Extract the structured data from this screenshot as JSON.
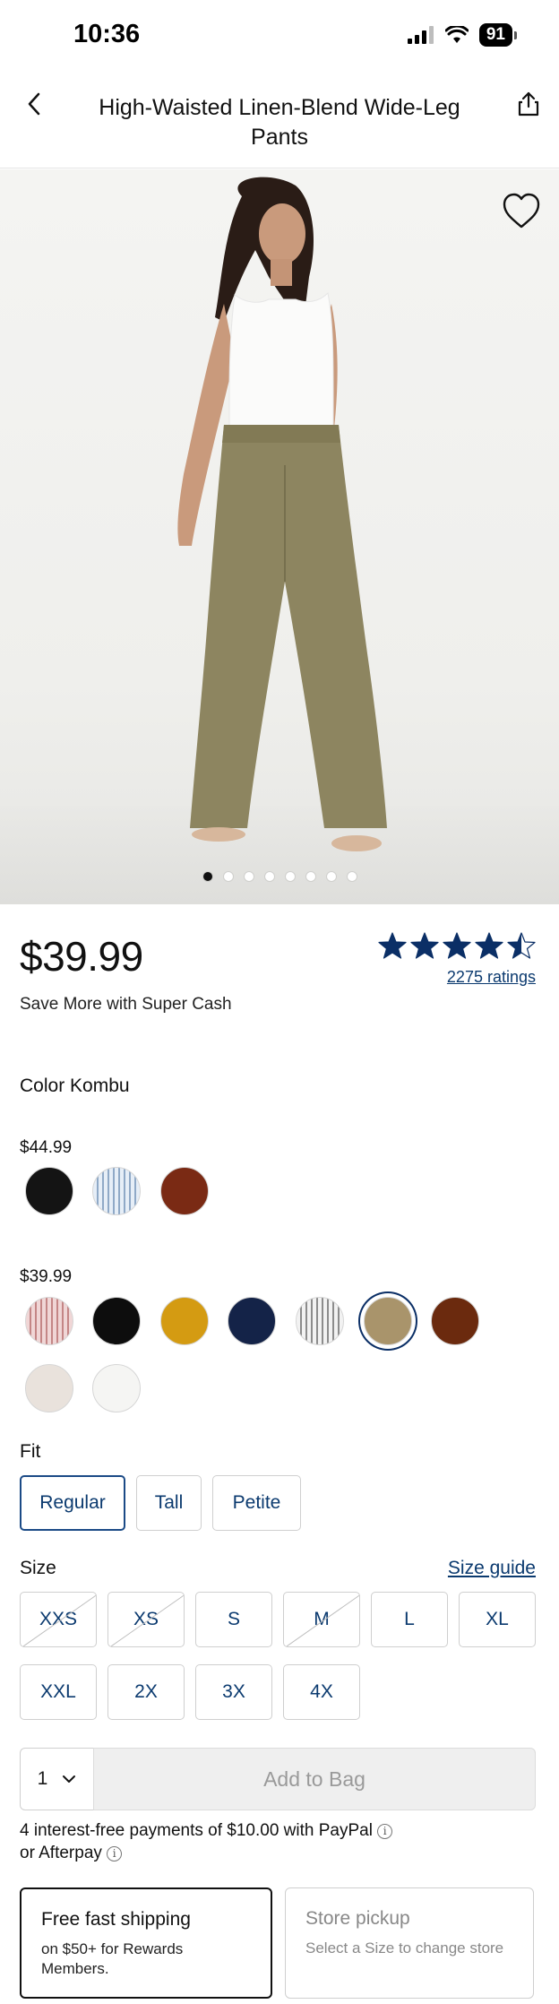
{
  "status": {
    "time": "10:36",
    "battery": "91"
  },
  "header": {
    "title": "High-Waisted Linen-Blend Wide-Leg Pants"
  },
  "gallery": {
    "image_count": 8,
    "active_index": 0
  },
  "pricing": {
    "price": "$39.99",
    "promo": "Save More with Super Cash"
  },
  "rating": {
    "stars": 4.5,
    "count_label": "2275 ratings"
  },
  "color": {
    "label": "Color Kombu",
    "tiers": [
      {
        "price": "$44.99",
        "swatches": [
          "#141414",
          "#b9cde3",
          "#7a2a14"
        ]
      },
      {
        "price": "$39.99",
        "swatches": [
          "#d9a8a8",
          "#0d0d0d",
          "#d49b12",
          "#142348",
          "#cfcfcf",
          "#a9946b",
          "#6b2a0e",
          "#e9e2dc",
          "#f5f5f3"
        ],
        "selected": 5
      }
    ]
  },
  "fit": {
    "label": "Fit",
    "options": [
      "Regular",
      "Tall",
      "Petite"
    ],
    "selected": 0
  },
  "size": {
    "label": "Size",
    "guide_label": "Size guide",
    "options": [
      {
        "label": "XXS",
        "available": false
      },
      {
        "label": "XS",
        "available": false
      },
      {
        "label": "S",
        "available": true
      },
      {
        "label": "M",
        "available": false
      },
      {
        "label": "L",
        "available": true
      },
      {
        "label": "XL",
        "available": true
      },
      {
        "label": "XXL",
        "available": true
      },
      {
        "label": "2X",
        "available": true
      },
      {
        "label": "3X",
        "available": true
      },
      {
        "label": "4X",
        "available": true
      }
    ]
  },
  "cart": {
    "quantity": "1",
    "add_label": "Add to Bag"
  },
  "payments": {
    "line1": "4 interest-free payments of $10.00 with PayPal",
    "line2": "or Afterpay"
  },
  "fulfillment": {
    "shipping": {
      "title": "Free fast shipping",
      "subtitle": "on $50+ for Rewards Members."
    },
    "pickup": {
      "title": "Store pickup",
      "subtitle": "Select a Size to change store"
    }
  },
  "colors": {
    "brand_navy": "#0b3a6f",
    "selected_border": "#1b4a86"
  }
}
